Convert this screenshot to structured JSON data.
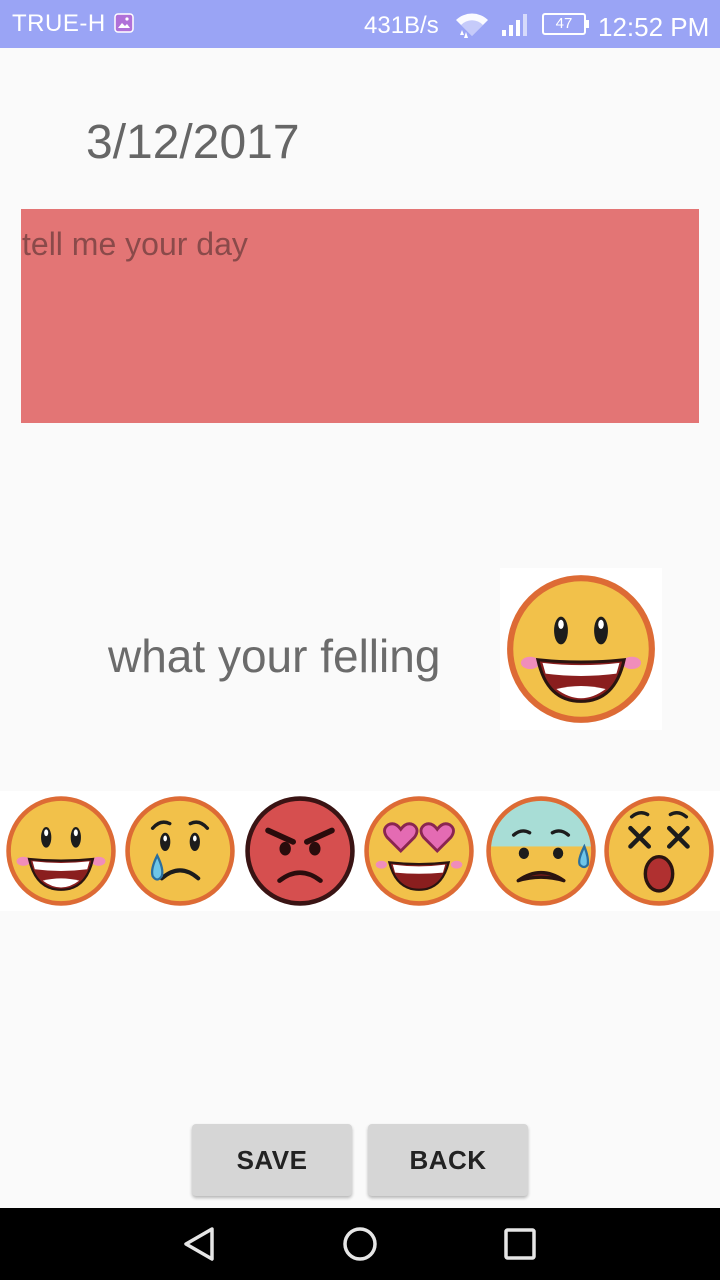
{
  "status_bar": {
    "carrier": "TRUE-H",
    "network_speed": "431B/s",
    "battery_level": "47",
    "time": "12:52 PM",
    "icons": [
      "gallery-icon",
      "wifi-icon",
      "signal-icon",
      "battery-icon"
    ]
  },
  "entry": {
    "date": "3/12/2017",
    "day_placeholder": "tell me your day",
    "day_value": ""
  },
  "feeling": {
    "label": "what your felling",
    "selected_mood": "happy"
  },
  "moods": [
    "happy",
    "crying",
    "angry",
    "in-love",
    "anxious",
    "shocked"
  ],
  "actions": {
    "save_label": "SAVE",
    "back_label": "BACK"
  },
  "colors": {
    "status_bar": "#9aa4f5",
    "day_box": "#e37575",
    "button": "#d6d6d6",
    "nav_bar": "#000000"
  }
}
